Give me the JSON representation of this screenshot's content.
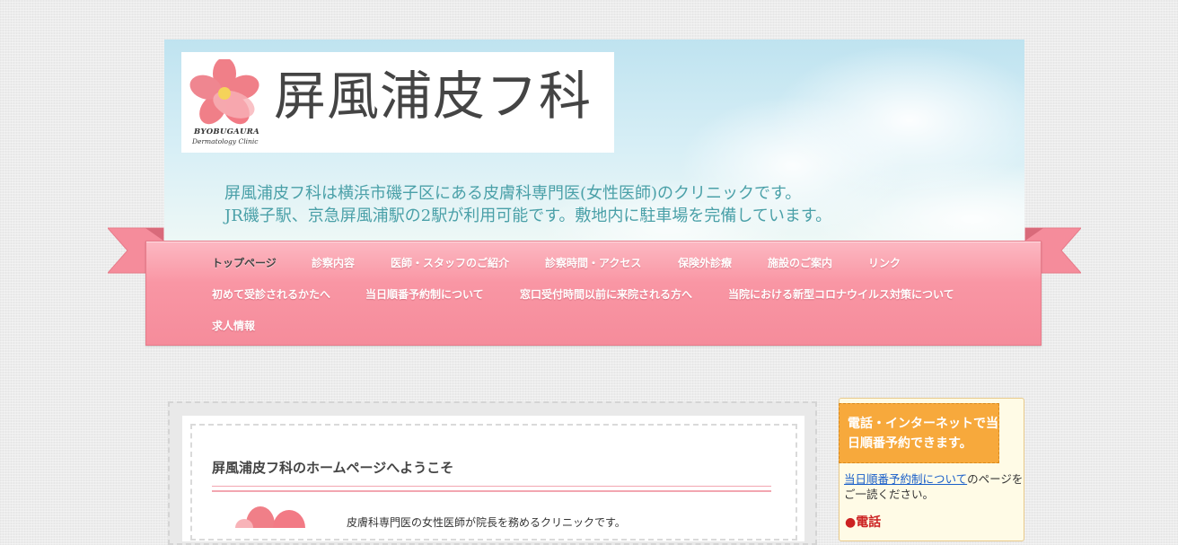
{
  "header": {
    "logo_title": "屏風浦皮フ科",
    "logo_en_line1": "BYOBUGAURA",
    "logo_en_line2": "Dermatology Clinic",
    "tagline_line1": "屏風浦皮フ科は横浜市磯子区にある皮膚科専門医(女性医師)のクリニックです。",
    "tagline_line2": "JR磯子駅、京急屏風浦駅の2駅が利用可能です。敷地内に駐車場を完備しています。"
  },
  "nav": {
    "items": [
      {
        "label": "トップページ"
      },
      {
        "label": "診察内容"
      },
      {
        "label": "医師・スタッフのご紹介"
      },
      {
        "label": "診察時間・アクセス"
      },
      {
        "label": "保険外診療"
      },
      {
        "label": "施設のご案内"
      },
      {
        "label": "リンク"
      },
      {
        "label": "初めて受診されるかたへ"
      },
      {
        "label": "当日順番予約制について"
      },
      {
        "label": "窓口受付時間以前に来院される方へ"
      },
      {
        "label": "当院における新型コロナウイルス対策について"
      },
      {
        "label": "求人情報"
      }
    ]
  },
  "main": {
    "welcome_title": "屏風浦皮フ科のホームページへようこそ",
    "intro_text": "皮膚科専門医の女性医師が院長を務めるクリニックです。"
  },
  "sidebar": {
    "reservation_box": "電話・インターネットで当日順番予約できます。",
    "link_text": "当日順番予約制について",
    "link_suffix": "のページをご一読ください。",
    "phone_heading": "●電話"
  },
  "colors": {
    "ribbon_pink": "#f996a4",
    "tagline_teal": "#4aa0a8",
    "sidebar_orange": "#f7a93c",
    "link_blue": "#1a5fc9",
    "phone_red": "#cc2222"
  }
}
